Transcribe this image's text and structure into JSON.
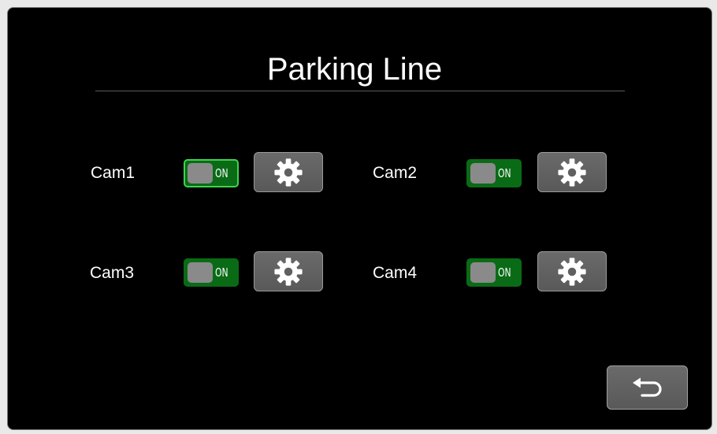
{
  "screen": {
    "title": "Parking Line"
  },
  "cameras": [
    {
      "label": "Cam1",
      "toggle_state": "ON",
      "enabled": true,
      "focused": true,
      "settings_icon": "gear-icon"
    },
    {
      "label": "Cam2",
      "toggle_state": "ON",
      "enabled": true,
      "focused": false,
      "settings_icon": "gear-icon"
    },
    {
      "label": "Cam3",
      "toggle_state": "ON",
      "enabled": true,
      "focused": false,
      "settings_icon": "gear-icon"
    },
    {
      "label": "Cam4",
      "toggle_state": "ON",
      "enabled": true,
      "focused": false,
      "settings_icon": "gear-icon"
    }
  ],
  "footer": {
    "back_icon": "return-arrow-icon"
  },
  "colors": {
    "background": "#000000",
    "toggle_on": "#0a6b16",
    "focus_outline": "#3ed24f",
    "button_gray": "#606060",
    "text": "#ffffff"
  }
}
